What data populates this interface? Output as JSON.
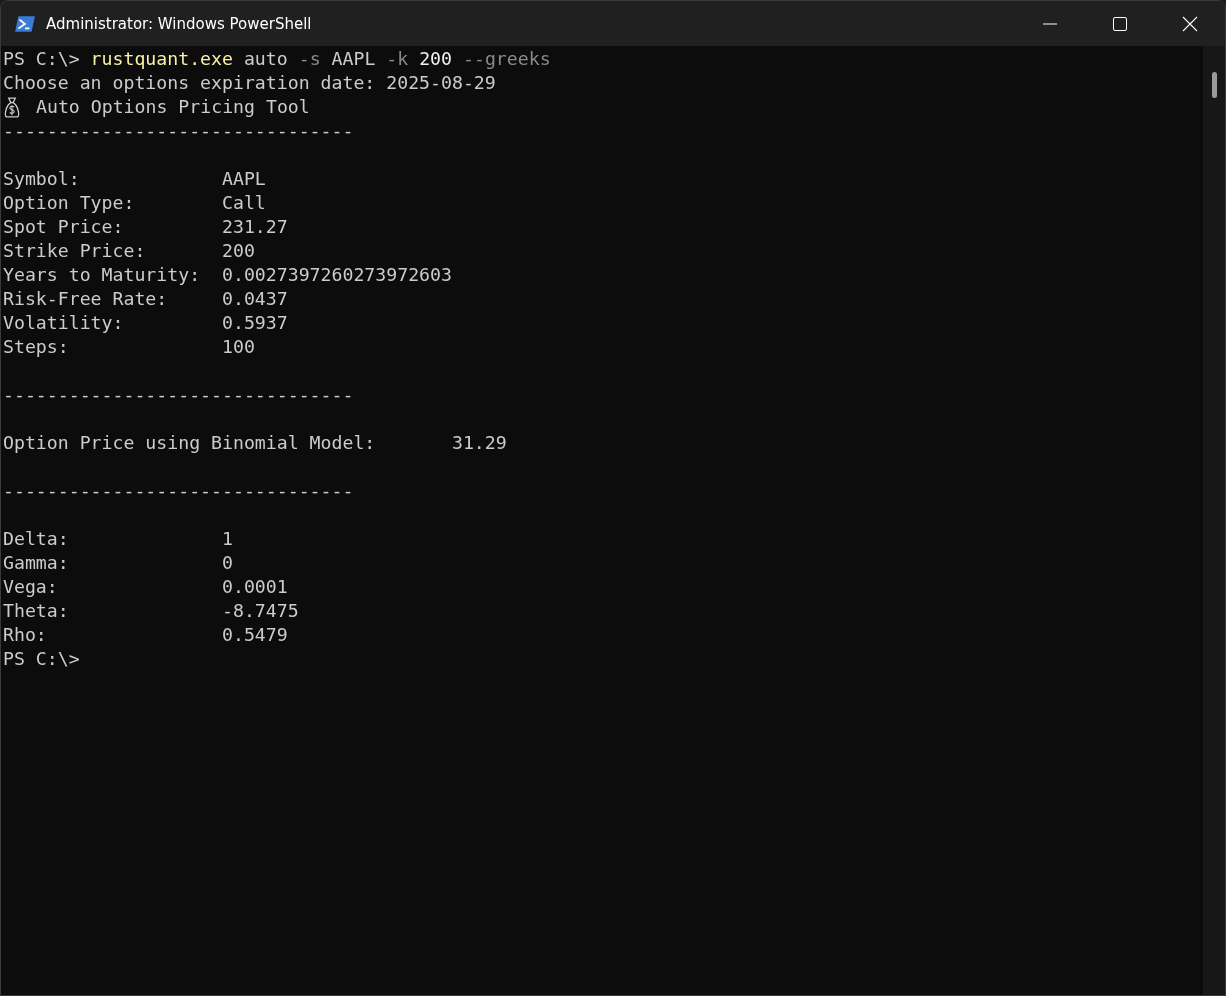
{
  "window": {
    "title": "Administrator: Windows PowerShell"
  },
  "lines": [
    {
      "kind": "command",
      "prompt": "PS C:\\>",
      "tokens": [
        {
          "kind": "exe",
          "text": "rustquant.exe"
        },
        {
          "kind": "word",
          "text": "auto"
        },
        {
          "kind": "flag",
          "text": "-s"
        },
        {
          "kind": "word",
          "text": "AAPL"
        },
        {
          "kind": "flag",
          "text": "-k"
        },
        {
          "kind": "number",
          "text": "200"
        },
        {
          "kind": "flag",
          "text": "--greeks"
        }
      ]
    },
    {
      "kind": "text",
      "text": "Choose an options expiration date: 2025-08-29"
    },
    {
      "kind": "heading",
      "text": "Auto Options Pricing Tool"
    },
    {
      "kind": "rule",
      "text": "--------------------------------"
    },
    {
      "kind": "blank"
    },
    {
      "kind": "field",
      "label": "Symbol:",
      "value": "AAPL"
    },
    {
      "kind": "field",
      "label": "Option Type:",
      "value": "Call"
    },
    {
      "kind": "field",
      "label": "Spot Price:",
      "value": "231.27"
    },
    {
      "kind": "field",
      "label": "Strike Price:",
      "value": "200"
    },
    {
      "kind": "field",
      "label": "Years to Maturity:",
      "value": "0.0027397260273972603"
    },
    {
      "kind": "field",
      "label": "Risk-Free Rate:",
      "value": "0.0437"
    },
    {
      "kind": "field",
      "label": "Volatility:",
      "value": "0.5937"
    },
    {
      "kind": "field",
      "label": "Steps:",
      "value": "100"
    },
    {
      "kind": "blank"
    },
    {
      "kind": "rule",
      "text": "--------------------------------"
    },
    {
      "kind": "blank"
    },
    {
      "kind": "result",
      "label": "Option Price using Binomial Model:",
      "value": "31.29"
    },
    {
      "kind": "blank"
    },
    {
      "kind": "rule",
      "text": "--------------------------------"
    },
    {
      "kind": "blank"
    },
    {
      "kind": "field",
      "label": "Delta:",
      "value": "1"
    },
    {
      "kind": "field",
      "label": "Gamma:",
      "value": "0"
    },
    {
      "kind": "field",
      "label": "Vega:",
      "value": "0.0001"
    },
    {
      "kind": "field",
      "label": "Theta:",
      "value": "-8.7475"
    },
    {
      "kind": "field",
      "label": "Rho:",
      "value": "0.5479"
    },
    {
      "kind": "prompt",
      "text": "PS C:\\>"
    }
  ]
}
